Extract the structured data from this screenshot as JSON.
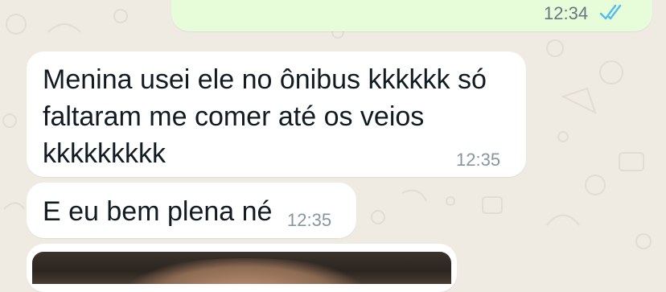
{
  "chat": {
    "outgoing": {
      "time": "12:34",
      "status_icon": "double-check-read-icon",
      "color": "#e7fcd9"
    },
    "messages": [
      {
        "text": "Menina usei ele no ônibus kkkkkk só faltaram me comer até os veios kkkkkkkkk",
        "time": "12:35"
      },
      {
        "text": "E eu bem plena né",
        "time": "12:35"
      }
    ],
    "image_message": {
      "content": "photo-thumbnail"
    }
  },
  "colors": {
    "background": "#efeae2",
    "incoming_bubble": "#ffffff",
    "tick_read": "#53bdeb",
    "timestamp": "#8696a0"
  }
}
